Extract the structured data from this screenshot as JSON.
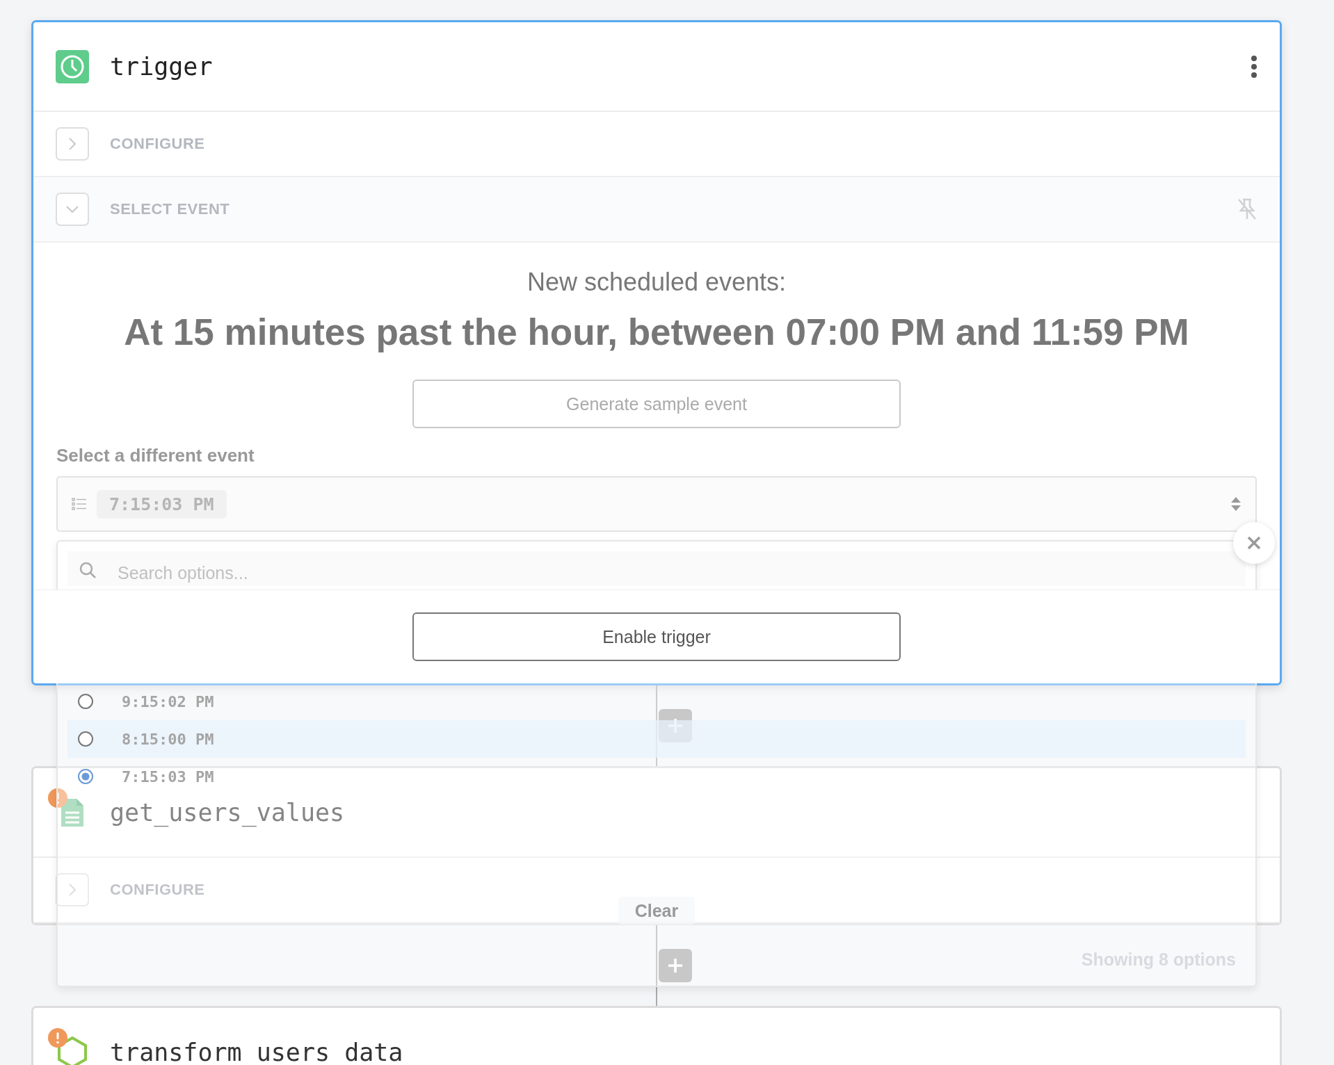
{
  "trigger": {
    "title": "trigger",
    "sections": [
      {
        "label": "CONFIGURE",
        "expanded": false
      },
      {
        "label": "SELECT EVENT",
        "expanded": true
      }
    ],
    "heading": "New scheduled events:",
    "schedule": "At 15 minutes past the hour, between 07:00 PM and 11:59 PM",
    "sample_button": "Generate sample event",
    "select_label": "Select a different event",
    "select_value": "7:15:03 PM",
    "enable_button": "Enable trigger"
  },
  "dropdown": {
    "search_placeholder": "Search options...",
    "options": [
      {
        "label": "9:15:02 PM",
        "selected": false,
        "highlighted": false
      },
      {
        "label": "8:15:00 PM",
        "selected": false,
        "highlighted": true
      },
      {
        "label": "7:15:03 PM",
        "selected": true,
        "highlighted": false
      }
    ],
    "clear": "Clear",
    "count": "Showing 8 options"
  },
  "steps": [
    {
      "title": "get_users_values",
      "kind": "sheet",
      "warning": true,
      "sections": [
        {
          "label": "CONFIGURE",
          "expanded": false
        }
      ]
    },
    {
      "title": "transform_users_data",
      "kind": "js",
      "warning": true
    }
  ]
}
